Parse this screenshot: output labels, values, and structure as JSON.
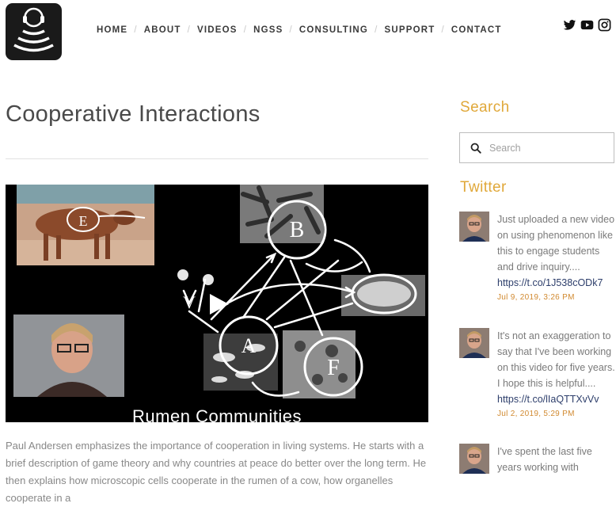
{
  "header": {
    "nav": [
      "HOME",
      "ABOUT",
      "VIDEOS",
      "NGSS",
      "CONSULTING",
      "SUPPORT",
      "CONTACT"
    ],
    "social_icons": [
      "twitter-icon",
      "youtube-icon",
      "instagram-icon"
    ]
  },
  "main": {
    "title": "Cooperative Interactions",
    "video": {
      "caption": "Rumen Communities",
      "letters": [
        "B",
        "A",
        "F",
        "E",
        "V"
      ]
    },
    "description": "Paul Andersen emphasizes the importance of cooperation in living systems. He starts with a brief description of game theory and why countries at peace do better over the long term. He then explains how microscopic cells cooperate in the rumen of a cow, how organelles cooperate in a"
  },
  "sidebar": {
    "search_title": "Search",
    "search_placeholder": "Search",
    "twitter_title": "Twitter",
    "tweets": [
      {
        "text": "Just uploaded a new video on using phenomenon like this to engage students and drive inquiry....",
        "link": "https://t.co/1J538cODk7",
        "date": "Jul 9, 2019, 3:26 PM"
      },
      {
        "text": "It's not an exaggeration to say that I've been working on this video for five years. I hope this is helpful....",
        "link": "https://t.co/lIaQTTXvVv",
        "date": "Jul 2, 2019, 5:29 PM"
      },
      {
        "text": "I've spent the last five years working with",
        "link": "",
        "date": ""
      }
    ]
  },
  "colors": {
    "accent": "#e0a83a",
    "date": "#d18a31",
    "link": "#2d3e6b"
  }
}
